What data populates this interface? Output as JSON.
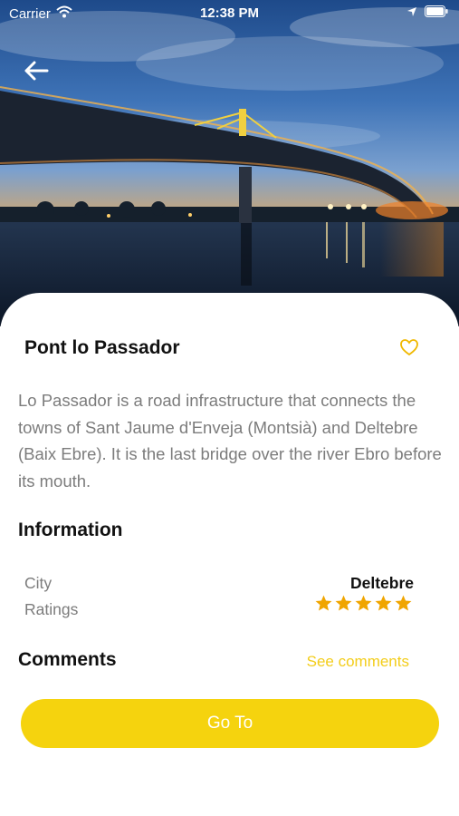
{
  "status_bar": {
    "carrier": "Carrier",
    "time": "12:38 PM"
  },
  "place": {
    "name": "Pont lo Passador",
    "description": "Lo Passador is a road infrastructure that connects the towns of Sant Jaume d'Enveja (Montsià) and Deltebre (Baix Ebre). It is the last bridge over the river Ebro before its mouth.",
    "favorite": false
  },
  "information": {
    "title": "Information",
    "city_label": "City",
    "city_value": "Deltebre",
    "ratings_label": "Ratings",
    "rating": 5,
    "rating_max": 5
  },
  "comments": {
    "title": "Comments",
    "see_comments": "See comments"
  },
  "go_button": "Go To",
  "colors": {
    "accent": "#f5d30e",
    "star": "#f0a500",
    "text_muted": "#7c7c7c"
  },
  "icons": [
    "wifi-icon",
    "location-arrow-icon",
    "battery-icon",
    "back-arrow-icon",
    "heart-icon",
    "star-icon"
  ]
}
